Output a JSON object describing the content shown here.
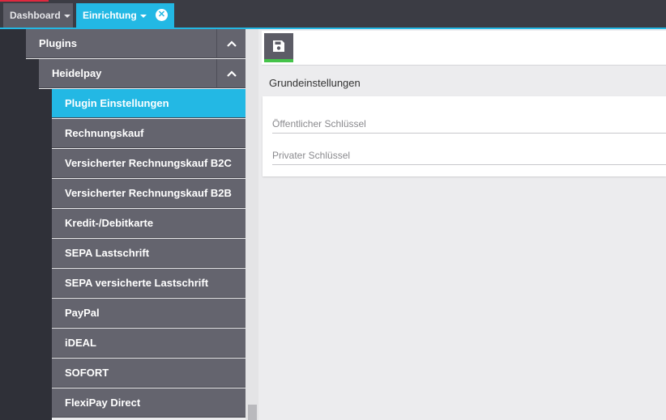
{
  "tabs": {
    "dashboard": "Dashboard",
    "einrichtung": "Einrichtung"
  },
  "sidebar": {
    "group": "Plugins",
    "subgroup": "Heidelpay",
    "items": [
      {
        "label": "Plugin Einstellungen",
        "active": true
      },
      {
        "label": "Rechnungskauf"
      },
      {
        "label": "Versicherter Rechnungskauf B2C"
      },
      {
        "label": "Versicherter Rechnungskauf B2B"
      },
      {
        "label": "Kredit-/Debitkarte"
      },
      {
        "label": "SEPA Lastschrift"
      },
      {
        "label": "SEPA versicherte Lastschrift"
      },
      {
        "label": "PayPal"
      },
      {
        "label": "iDEAL"
      },
      {
        "label": "SOFORT"
      },
      {
        "label": "FlexiPay Direct"
      }
    ]
  },
  "main": {
    "section_title": "Grundeinstellungen",
    "fields": [
      {
        "placeholder": "Öffentlicher Schlüssel"
      },
      {
        "placeholder": "Privater Schlüssel"
      }
    ]
  },
  "colors": {
    "accent": "#23b8e4",
    "nav_bg": "#64646e",
    "save_indicator": "#45c34a"
  },
  "icons": {
    "save": "floppy-disk-icon",
    "collapse": "chevron-up-icon",
    "close": "close-circle-icon"
  }
}
